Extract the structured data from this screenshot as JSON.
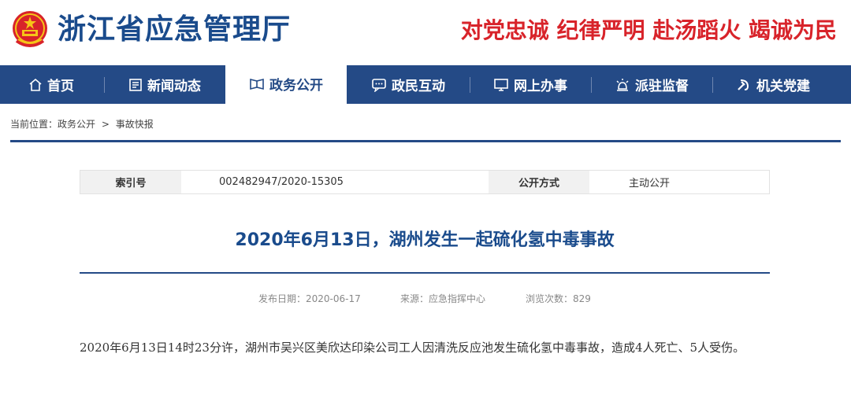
{
  "header": {
    "site_title": "浙江省应急管理厅",
    "slogan": "对党忠诚 纪律严明 赴汤蹈火 竭诚为民",
    "brand_color": "#1a4b8c",
    "slogan_color": "#d8232a"
  },
  "nav": {
    "background": "#244a86",
    "items": [
      {
        "label": "首页",
        "icon": "home-icon",
        "active": false
      },
      {
        "label": "新闻动态",
        "icon": "newspaper-icon",
        "active": false
      },
      {
        "label": "政务公开",
        "icon": "book-icon",
        "active": true
      },
      {
        "label": "政民互动",
        "icon": "chat-icon",
        "active": false
      },
      {
        "label": "网上办事",
        "icon": "monitor-icon",
        "active": false
      },
      {
        "label": "派驻监督",
        "icon": "lamp-icon",
        "active": false
      },
      {
        "label": "机关党建",
        "icon": "hammer-sickle-icon",
        "active": false
      }
    ]
  },
  "breadcrumb": {
    "prefix": "当前位置：",
    "items": [
      "政务公开",
      "事故快报"
    ],
    "separator": ">"
  },
  "info": {
    "index_label": "索引号",
    "index_value": "002482947/2020-15305",
    "method_label": "公开方式",
    "method_value": "主动公开"
  },
  "article": {
    "title": "2020年6月13日，湖州发生一起硫化氢中毒事故",
    "publish_date": "发布日期：2020-06-17",
    "source": "来源：应急指挥中心",
    "views": "浏览次数：829",
    "body": "2020年6月13日14时23分许，湖州市吴兴区美欣达印染公司工人因清洗反应池发生硫化氢中毒事故，造成4人死亡、5人受伤。"
  }
}
